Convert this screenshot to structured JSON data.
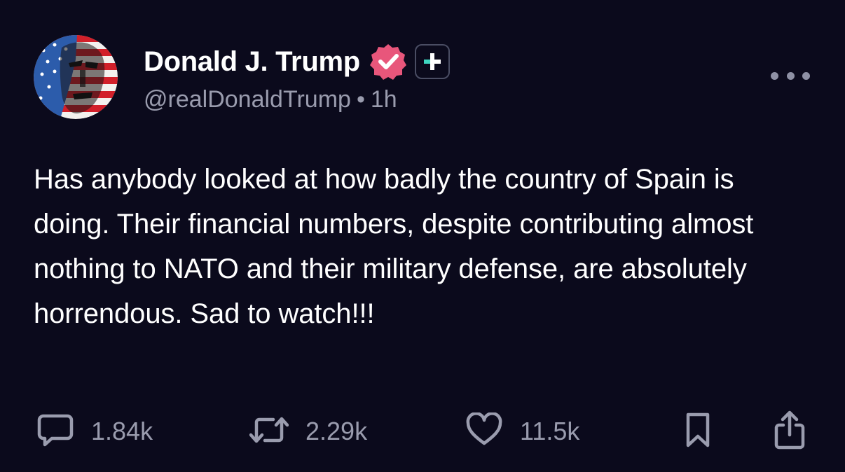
{
  "post": {
    "author": {
      "display_name": "Donald J. Trump",
      "handle": "@realDonaldTrump",
      "separator": "•",
      "timestamp": "1h",
      "avatar_icon": "flag-portrait-avatar",
      "verified_icon": "verified-badge-icon",
      "plus_icon": "plus-badge-icon"
    },
    "text": "Has anybody looked at how badly the country of Spain is doing. Their financial numbers, despite contributing almost nothing to NATO and their military defense, are absolutely horrendous. Sad to watch!!!",
    "actions": {
      "replies": "1.84k",
      "reposts": "2.29k",
      "likes": "11.5k"
    }
  },
  "colors": {
    "background": "#0b0a1c",
    "text_primary": "#ffffff",
    "text_secondary": "#9a9cae",
    "verified_badge": "#e8567b",
    "plus_accent": "#3fd6c0"
  }
}
